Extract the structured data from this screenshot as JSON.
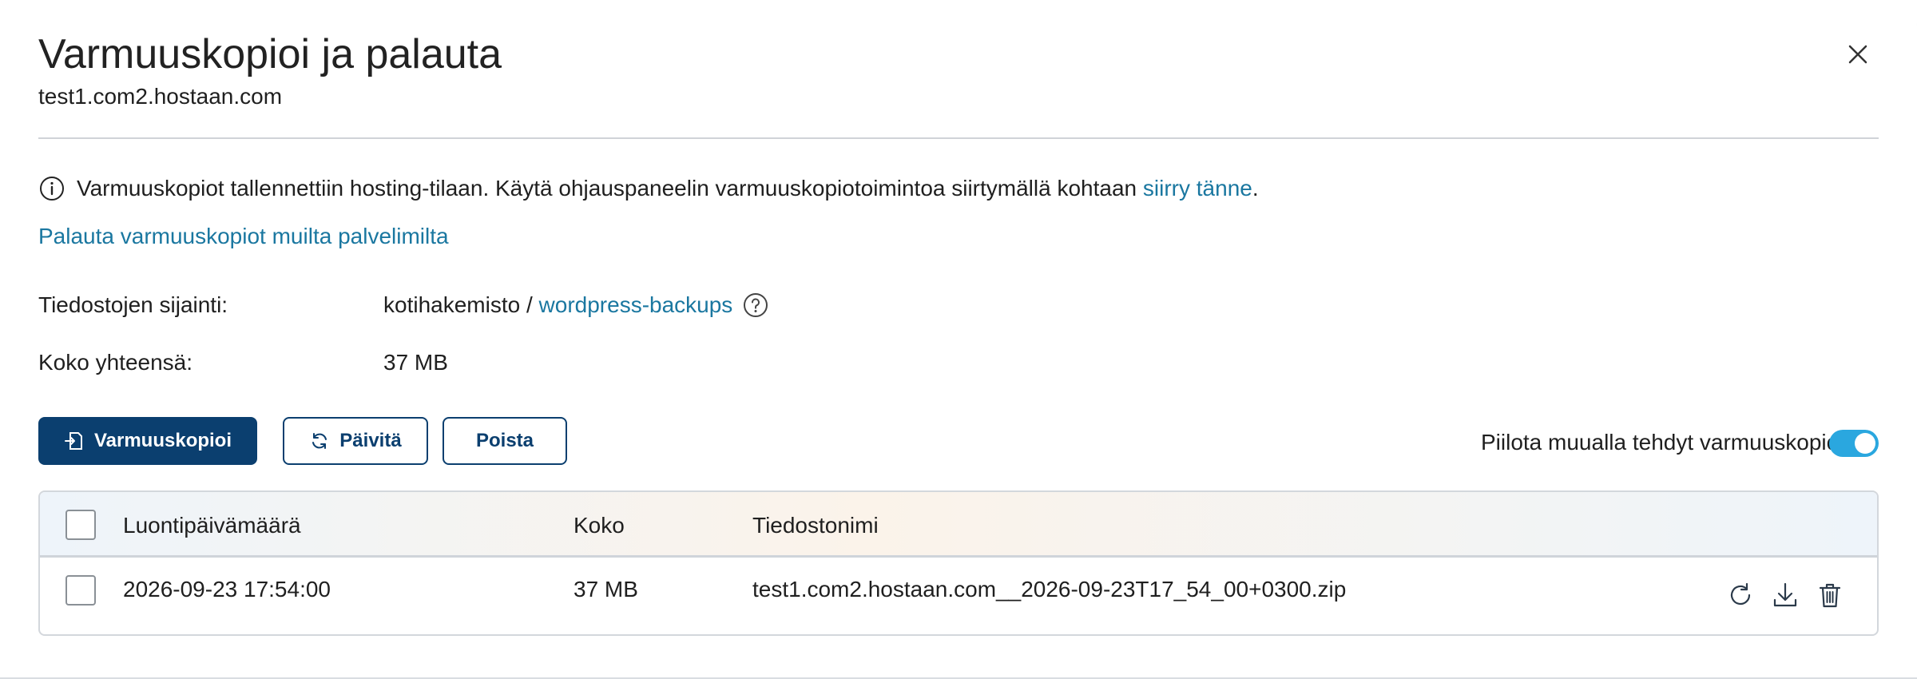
{
  "dialog": {
    "title": "Varmuuskopioi ja palauta",
    "subtitle": "test1.com2.hostaan.com",
    "close_icon": "close-icon"
  },
  "info": {
    "icon": "info-icon",
    "text": "Varmuuskopiot tallennettiin hosting-tilaan. Käytä ohjauspaneelin varmuuskopiotoimintoa siirtymällä kohtaan ",
    "link": "siirry tänne",
    "suffix": "."
  },
  "restore_link": "Palauta varmuuskopiot muilta palvelimilta",
  "location": {
    "label": "Tiedostojen sijainti:",
    "prefix": "kotihakemisto / ",
    "link": "wordpress-backups",
    "help_icon": "help-icon"
  },
  "total": {
    "label": "Koko yhteensä:",
    "value": "37 MB"
  },
  "toolbar": {
    "backup_label": "Varmuuskopioi",
    "refresh_label": "Päivitä",
    "delete_label": "Poista",
    "toggle_label": "Piilota muualla tehdyt varmuuskopiot",
    "toggle_on": true
  },
  "table": {
    "columns": [
      "Luontipäivämäärä",
      "Koko",
      "Tiedostonimi"
    ],
    "rows": [
      {
        "date": "2026-09-23 17:54:00",
        "size": "37 MB",
        "filename": "test1.com2.hostaan.com__2026-09-23T17_54_00+0300.zip",
        "actions": [
          "restore-icon",
          "download-icon",
          "trash-icon"
        ]
      }
    ]
  },
  "colors": {
    "primary": "#0b3f6f",
    "link": "#1a77a0",
    "toggle": "#2aa7df"
  }
}
